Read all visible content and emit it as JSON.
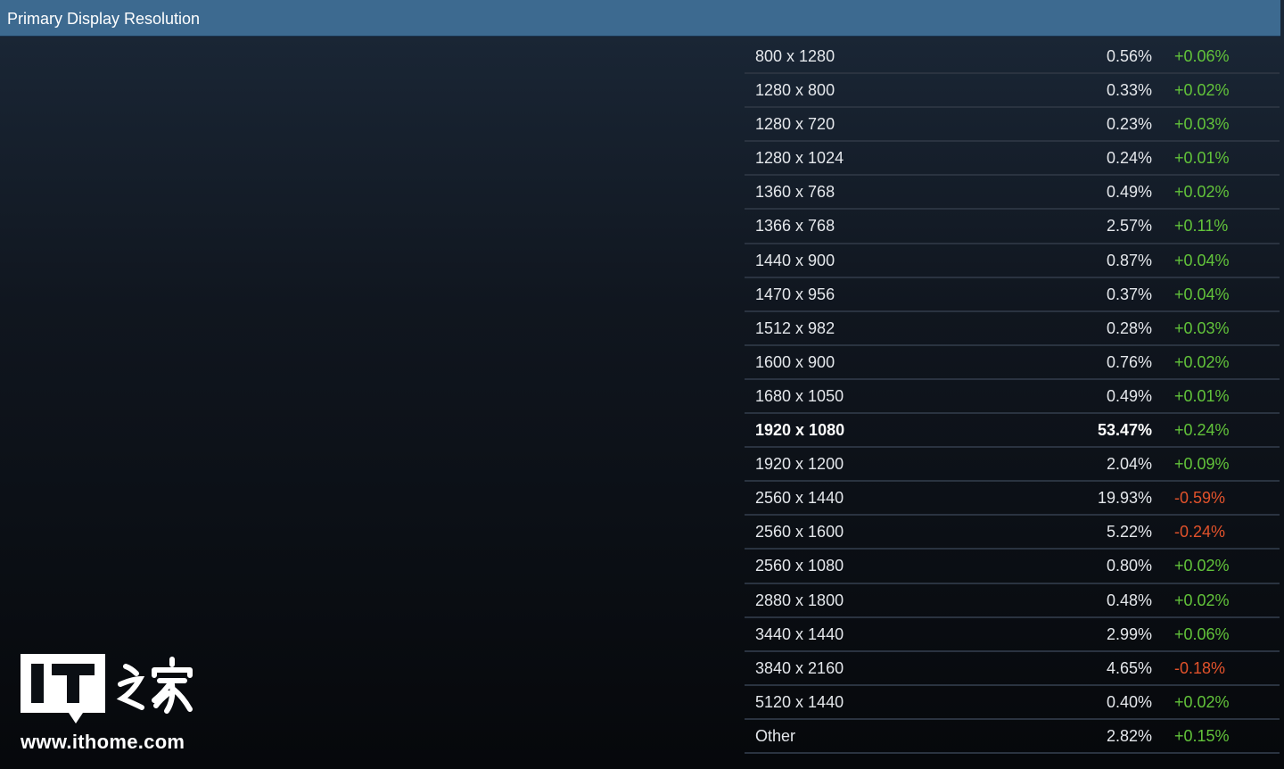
{
  "header": {
    "title": "Primary Display Resolution"
  },
  "rows": [
    {
      "res": "800 x 1280",
      "pct": "0.56%",
      "chg": "+0.06%",
      "dir": "pos",
      "bold": false
    },
    {
      "res": "1280 x 800",
      "pct": "0.33%",
      "chg": "+0.02%",
      "dir": "pos",
      "bold": false
    },
    {
      "res": "1280 x 720",
      "pct": "0.23%",
      "chg": "+0.03%",
      "dir": "pos",
      "bold": false
    },
    {
      "res": "1280 x 1024",
      "pct": "0.24%",
      "chg": "+0.01%",
      "dir": "pos",
      "bold": false
    },
    {
      "res": "1360 x 768",
      "pct": "0.49%",
      "chg": "+0.02%",
      "dir": "pos",
      "bold": false
    },
    {
      "res": "1366 x 768",
      "pct": "2.57%",
      "chg": "+0.11%",
      "dir": "pos",
      "bold": false
    },
    {
      "res": "1440 x 900",
      "pct": "0.87%",
      "chg": "+0.04%",
      "dir": "pos",
      "bold": false
    },
    {
      "res": "1470 x 956",
      "pct": "0.37%",
      "chg": "+0.04%",
      "dir": "pos",
      "bold": false
    },
    {
      "res": "1512 x 982",
      "pct": "0.28%",
      "chg": "+0.03%",
      "dir": "pos",
      "bold": false
    },
    {
      "res": "1600 x 900",
      "pct": "0.76%",
      "chg": "+0.02%",
      "dir": "pos",
      "bold": false
    },
    {
      "res": "1680 x 1050",
      "pct": "0.49%",
      "chg": "+0.01%",
      "dir": "pos",
      "bold": false
    },
    {
      "res": "1920 x 1080",
      "pct": "53.47%",
      "chg": "+0.24%",
      "dir": "pos",
      "bold": true
    },
    {
      "res": "1920 x 1200",
      "pct": "2.04%",
      "chg": "+0.09%",
      "dir": "pos",
      "bold": false
    },
    {
      "res": "2560 x 1440",
      "pct": "19.93%",
      "chg": "-0.59%",
      "dir": "neg",
      "bold": false
    },
    {
      "res": "2560 x 1600",
      "pct": "5.22%",
      "chg": "-0.24%",
      "dir": "neg",
      "bold": false
    },
    {
      "res": "2560 x 1080",
      "pct": "0.80%",
      "chg": "+0.02%",
      "dir": "pos",
      "bold": false
    },
    {
      "res": "2880 x 1800",
      "pct": "0.48%",
      "chg": "+0.02%",
      "dir": "pos",
      "bold": false
    },
    {
      "res": "3440 x 1440",
      "pct": "2.99%",
      "chg": "+0.06%",
      "dir": "pos",
      "bold": false
    },
    {
      "res": "3840 x 2160",
      "pct": "4.65%",
      "chg": "-0.18%",
      "dir": "neg",
      "bold": false
    },
    {
      "res": "5120 x 1440",
      "pct": "0.40%",
      "chg": "+0.02%",
      "dir": "pos",
      "bold": false
    },
    {
      "res": "Other",
      "pct": "2.82%",
      "chg": "+0.15%",
      "dir": "pos",
      "bold": false
    }
  ],
  "watermark": {
    "logo_text": "IT之家",
    "url": "www.ithome.com"
  },
  "colors": {
    "header_bg": "#3d6a90",
    "positive": "#62c33a",
    "negative": "#e2522b"
  }
}
